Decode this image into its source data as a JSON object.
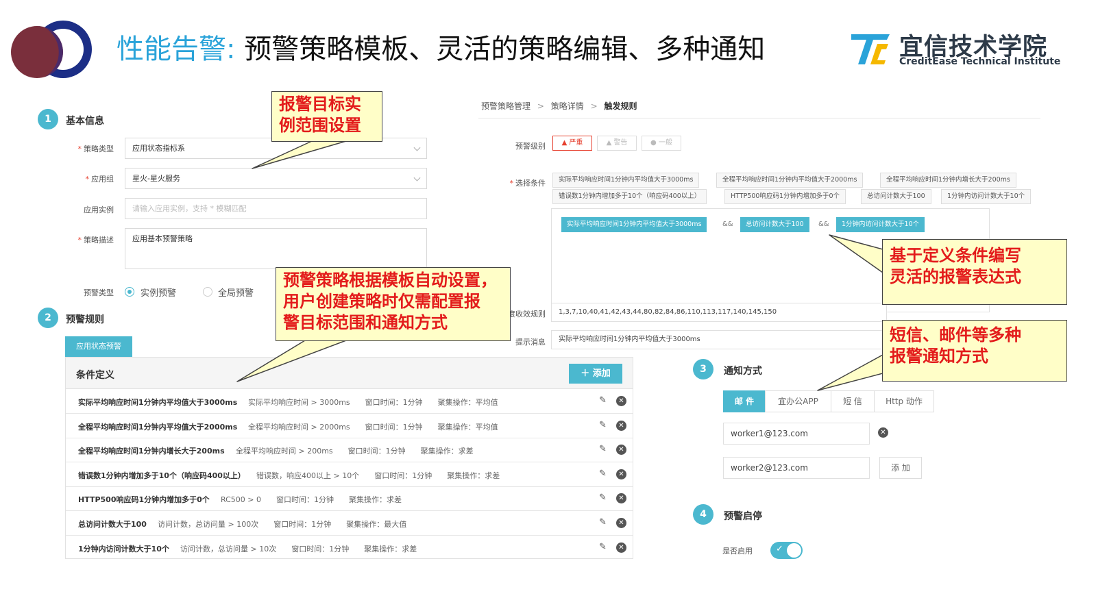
{
  "header": {
    "title_highlight": "性能告警:",
    "title_rest": " 预警策略模板、灵活的策略编辑、多种通知",
    "brand_name": "宜信技术学院",
    "brand_sub": "CreditEase Technical Institute"
  },
  "step1": {
    "number": "1",
    "title": "基本信息",
    "strategy_type_label": "策略类型",
    "strategy_type_value": "应用状态指标系",
    "app_group_label": "应用组",
    "app_group_value": "星火-星火服务",
    "app_instance_label": "应用实例",
    "app_instance_placeholder": "请输入应用实例，支持 * 模糊匹配",
    "description_label": "策略描述",
    "description_value": "应用基本预警策略",
    "alert_type_label": "预警类型",
    "alert_type_options": [
      "实例预警",
      "全局预警"
    ]
  },
  "step2": {
    "number": "2",
    "title": "预警规则",
    "tab_label": "应用状态预警",
    "panel_title": "条件定义",
    "add_button": "＋ 添加",
    "rows": [
      {
        "name": "实际平均响应时间1分钟内平均值大于3000ms",
        "detail": "实际平均响应时间 > 3000ms　　窗口时间：1分钟　　聚集操作：平均值"
      },
      {
        "name": "全程平均响应时间1分钟内平均值大于2000ms",
        "detail": "全程平均响应时间 > 2000ms　　窗口时间：1分钟　　聚集操作：平均值"
      },
      {
        "name": "全程平均响应时间1分钟内增长大于200ms",
        "detail": "全程平均响应时间 > 200ms　　窗口时间：1分钟　　聚集操作：求差"
      },
      {
        "name": "错误数1分钟内增加多于10个（响应码400以上）",
        "detail": "错误数，响应400以上 > 10个　　窗口时间：1分钟　　聚集操作：求差"
      },
      {
        "name": "HTTP500响应码1分钟内增加多于0个",
        "detail": "RC500 > 0　　窗口时间：1分钟　　聚集操作：求差"
      },
      {
        "name": "总访问计数大于100",
        "detail": "访问计数，总访问量 > 100次　　窗口时间：1分钟　　聚集操作：最大值"
      },
      {
        "name": "1分钟内访问计数大于10个",
        "detail": "访问计数，总访问量 > 10次　　窗口时间：1分钟　　聚集操作：求差"
      }
    ]
  },
  "rule_editor": {
    "breadcrumb": [
      "预警策略管理",
      "策略详情",
      "触发规则"
    ],
    "breadcrumb_sep": ">",
    "level_label": "预警级别",
    "levels": [
      "▲ 严重",
      "▲ 警告",
      "● 一般"
    ],
    "selected_level": "▲ 严重",
    "conditions_label": "选择条件",
    "condition_chips": [
      "实际平均响应时间1分钟内平均值大于3000ms",
      "全程平均响应时间1分钟内平均值大于2000ms",
      "全程平均响应时间1分钟内增长大于200ms",
      "错误数1分钟内增加多于10个（响应码400以上）",
      "HTTP500响应码1分钟内增加多于0个",
      "总访问计数大于100",
      "1分钟内访问计数大于10个"
    ],
    "expression": [
      "实际平均响应时间1分钟内平均值大于3000ms",
      "总访问计数大于100",
      "1分钟内访问计数大于10个"
    ],
    "and_operator": "&&",
    "effective_rule_label": "度收效规则",
    "effective_rule_value": "1,3,7,10,40,41,42,43,44,80,82,84,86,110,113,117,140,145,150",
    "message_label": "提示消息",
    "message_value": "实际平均响应时间1分钟内平均值大于3000ms"
  },
  "step3": {
    "number": "3",
    "title": "通知方式",
    "tabs": [
      "邮 件",
      "宜办公APP",
      "短 信",
      "Http 动作"
    ],
    "active_tab": "邮 件",
    "emails": [
      "worker1@123.com",
      "worker2@123.com"
    ],
    "add_label": "添 加"
  },
  "step4": {
    "number": "4",
    "title": "预警启停",
    "enable_label": "是否启用",
    "enabled": true
  },
  "callouts": {
    "target_range": [
      "报警目标实",
      "例范围设置"
    ],
    "template_auto": [
      "预警策略根据模板自动设置，",
      "用户创建策略时仅需配置报",
      "警目标范围和通知方式"
    ],
    "expression": [
      "基于定义条件编写",
      "灵活的报警表达式"
    ],
    "notify": [
      "短信、邮件等多种",
      "报警通知方式"
    ]
  },
  "colors": {
    "accent": "#4bb8cf",
    "title_blue": "#2aa3d9",
    "danger": "#e6402f",
    "callout_bg": "#fffec8",
    "callout_text": "#e31b1b"
  }
}
